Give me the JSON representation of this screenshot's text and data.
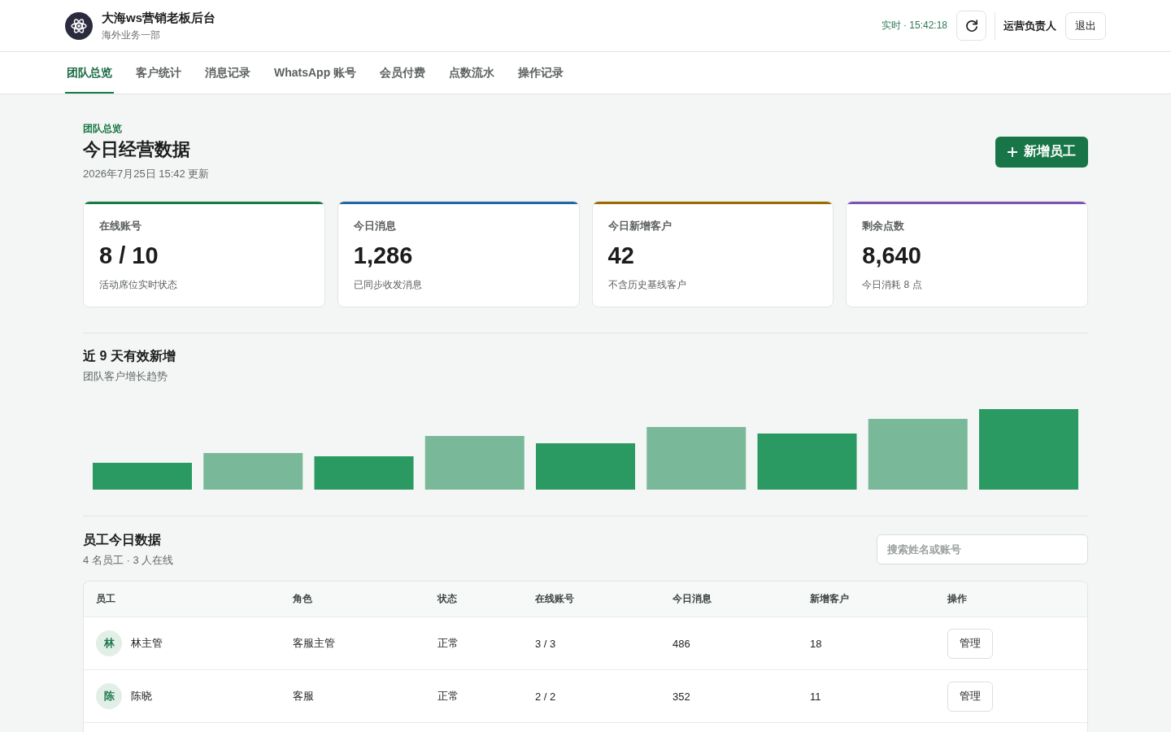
{
  "header": {
    "app_title": "大海ws营销老板后台",
    "subtitle": "海外业务一部",
    "live_status": "实时 · 15:42:18",
    "user_role": "运营负责人",
    "logout_button": "退出"
  },
  "nav_tabs": [
    {
      "label": "团队总览",
      "selected": true
    },
    {
      "label": "客户统计",
      "selected": false
    },
    {
      "label": "消息记录",
      "selected": false
    },
    {
      "label": "WhatsApp 账号",
      "selected": false
    },
    {
      "label": "会员付费",
      "selected": false
    },
    {
      "label": "点数流水",
      "selected": false
    },
    {
      "label": "操作记录",
      "selected": false
    }
  ],
  "page_header": {
    "breadcrumb": "团队总览",
    "title": "今日经营数据",
    "updated": "2026年7月25日 15:42 更新",
    "add_button": "新增员工"
  },
  "stat_cards": [
    {
      "label": "在线账号",
      "value": "8 / 10",
      "note": "活动席位实时状态",
      "color": "#1a7a46"
    },
    {
      "label": "今日消息",
      "value": "1,286",
      "note": "已同步收发消息",
      "color": "#2166a6"
    },
    {
      "label": "今日新增客户",
      "value": "42",
      "note": "不含历史基线客户",
      "color": "#9c6c00"
    },
    {
      "label": "剩余点数",
      "value": "8,640",
      "note": "今日消耗 8 点",
      "color": "#7d52b3"
    }
  ],
  "trend": {
    "title": "近 9 天有效新增",
    "subtitle": "团队客户增长趋势"
  },
  "staff": {
    "title": "员工今日数据",
    "summary": "4 名员工 · 3 人在线",
    "search": {
      "placeholder": "搜索姓名或账号"
    },
    "columns": [
      "员工",
      "角色",
      "状态",
      "在线账号",
      "今日消息",
      "新增客户",
      "操作"
    ],
    "rows": [
      {
        "avatar": "林",
        "name": "林主管",
        "role": "客服主管",
        "status": "正常",
        "online_accounts": "3 / 3",
        "messages": "486",
        "new_customers": "18",
        "action": "管理"
      },
      {
        "avatar": "陈",
        "name": "陈晓",
        "role": "客服",
        "status": "正常",
        "online_accounts": "2 / 2",
        "messages": "352",
        "new_customers": "11",
        "action": "管理"
      }
    ]
  }
}
